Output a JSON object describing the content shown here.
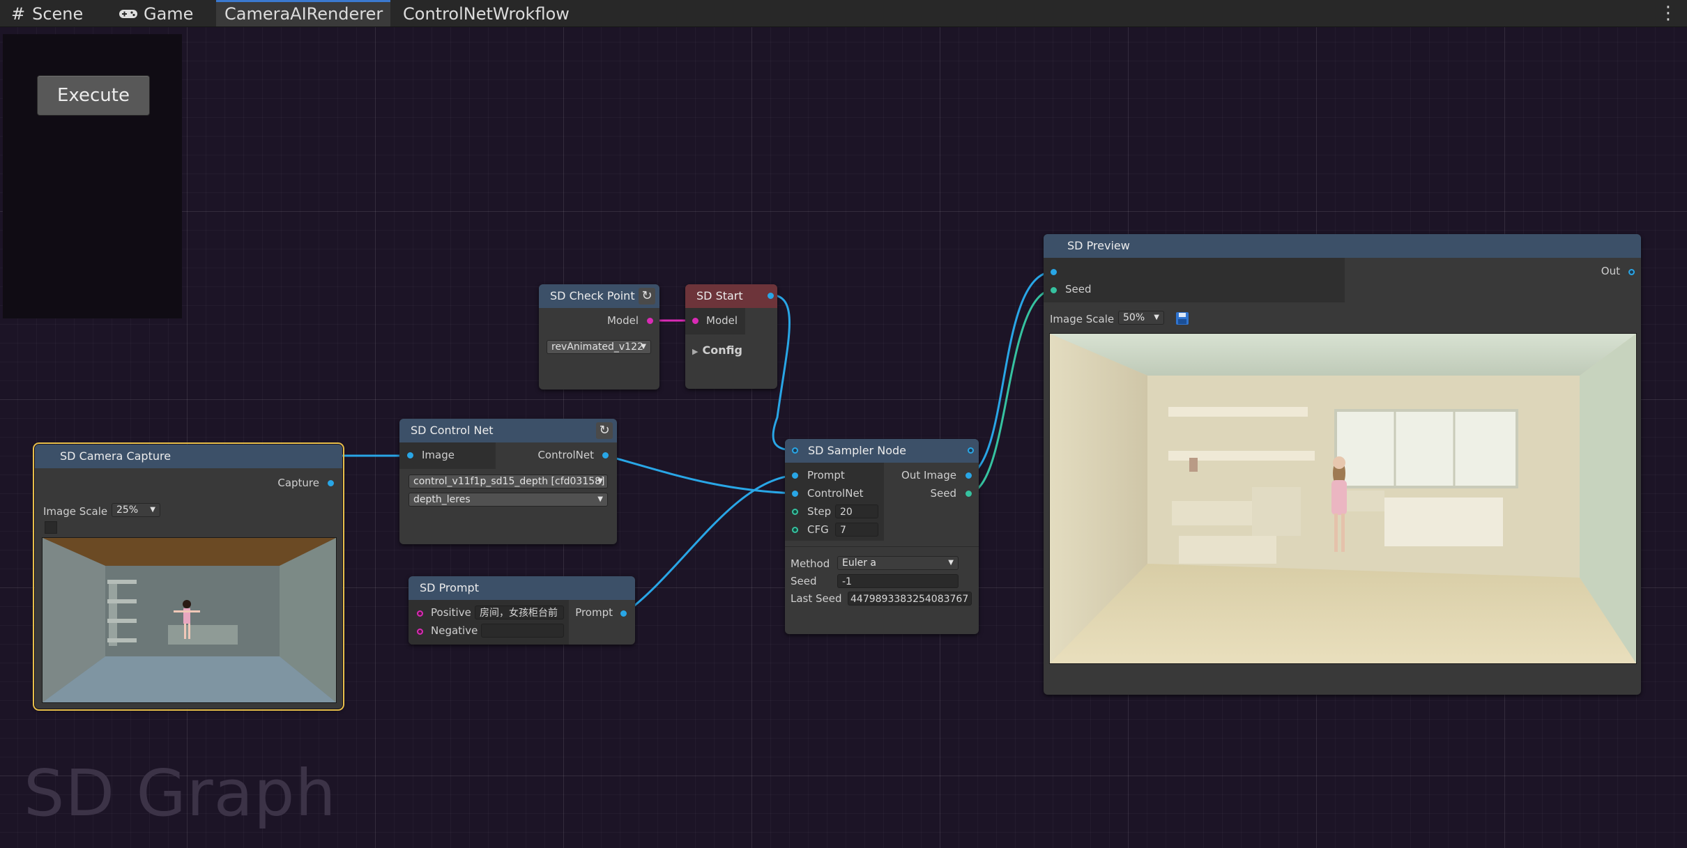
{
  "tabs": [
    {
      "label": "Scene",
      "icon": "grid-hash-icon"
    },
    {
      "label": "Game",
      "icon": "gamepad-icon"
    },
    {
      "label": "CameraAIRenderer",
      "active": true
    },
    {
      "label": "ControlNetWrokflow"
    }
  ],
  "toolbar": {
    "execute_label": "Execute"
  },
  "nodes": {
    "checkpoint": {
      "title": "SD Check Point",
      "out_label": "Model",
      "model_value": "revAnimated_v122"
    },
    "start": {
      "title": "SD Start",
      "in_label": "Model",
      "config_label": "Config"
    },
    "camera": {
      "title": "SD Camera Capture",
      "out_label": "Capture",
      "scale_label": "Image Scale",
      "scale_value": "25%"
    },
    "controlnet": {
      "title": "SD Control Net",
      "in_label": "Image",
      "out_label": "ControlNet",
      "model_value": "control_v11f1p_sd15_depth [cfd03158]",
      "preprocessor_value": "depth_leres"
    },
    "prompt": {
      "title": "SD Prompt",
      "positive_label": "Positive",
      "positive_value": "房间，女孩柜台前",
      "negative_label": "Negative",
      "negative_value": "",
      "out_label": "Prompt"
    },
    "sampler": {
      "title": "SD Sampler Node",
      "prompt_label": "Prompt",
      "controlnet_label": "ControlNet",
      "step_label": "Step",
      "step_value": "20",
      "cfg_label": "CFG",
      "cfg_value": "7",
      "out_image_label": "Out Image",
      "seed_out_label": "Seed",
      "method_label": "Method",
      "method_value": "Euler a",
      "seed_label": "Seed",
      "seed_value": "-1",
      "last_seed_label": "Last Seed",
      "last_seed_value": "4479893383254083767"
    },
    "preview": {
      "title": "SD Preview",
      "seed_label": "Seed",
      "out_label": "Out",
      "scale_label": "Image Scale",
      "scale_value": "50%"
    }
  },
  "watermark": "SD Graph",
  "colors": {
    "canvas": "#1c1426",
    "image_wire": "#29a6e6",
    "model_wire": "#d92bb5",
    "seed_wire": "#36c2a0",
    "selection": "#e7bf4a"
  }
}
